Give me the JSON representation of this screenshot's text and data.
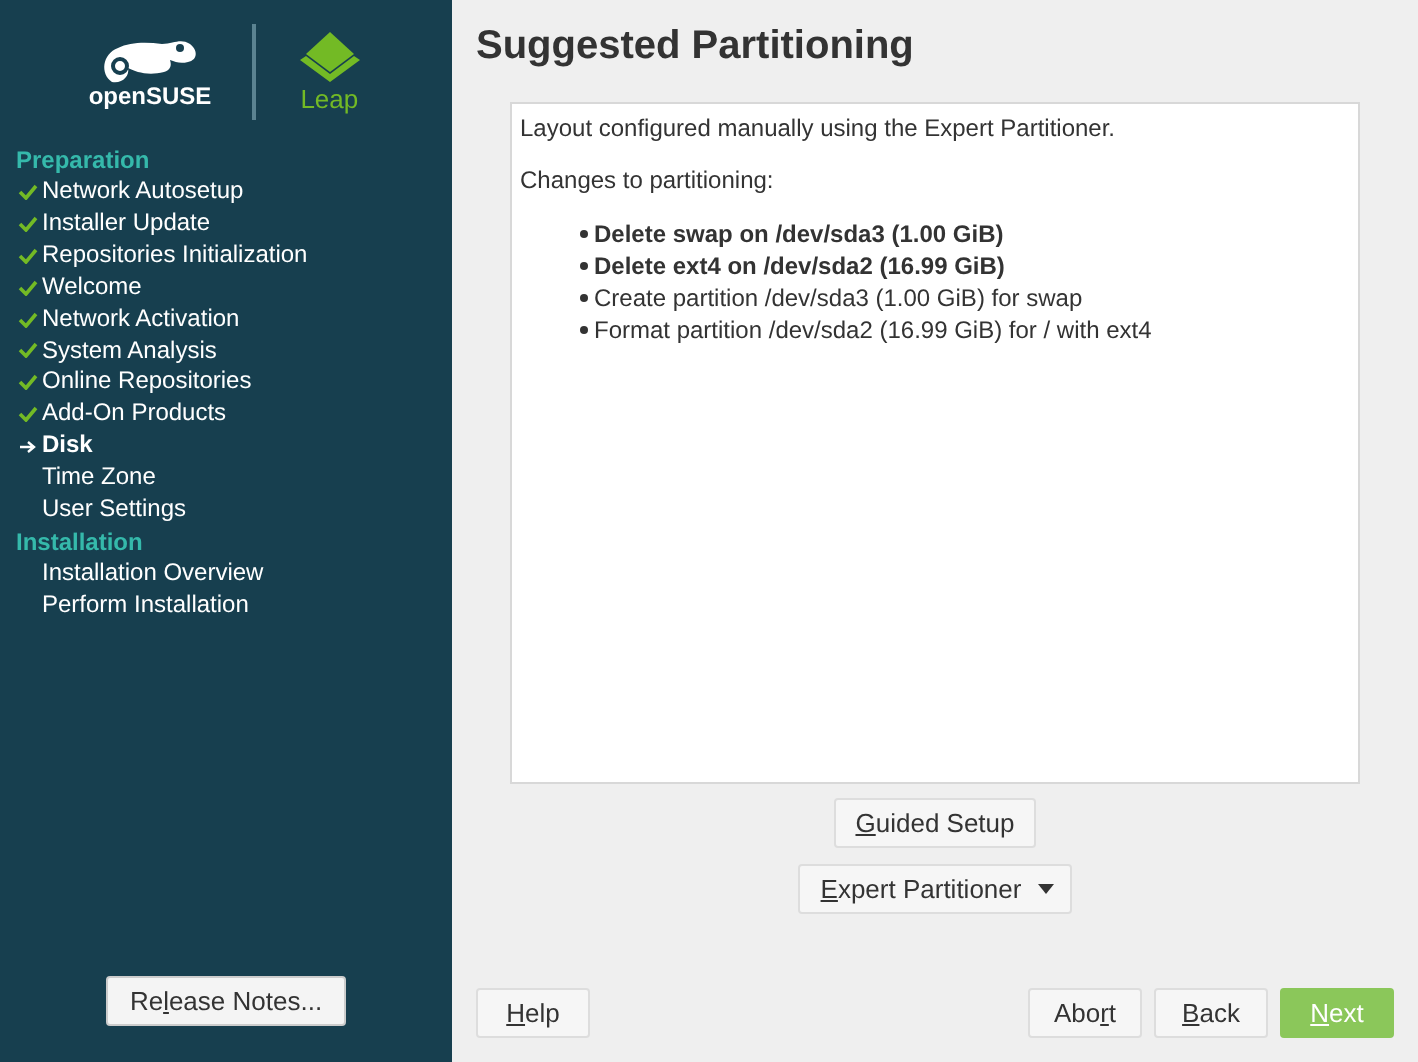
{
  "sidebar": {
    "logo_text": "openSUSE",
    "product": "Leap",
    "groups": [
      {
        "title": "Preparation",
        "items": [
          {
            "label": "Network Autosetup",
            "checked": true,
            "selected": false
          },
          {
            "label": "Installer Update",
            "checked": true,
            "selected": false
          },
          {
            "label": "Repositories Initialization",
            "checked": true,
            "selected": false
          },
          {
            "label": "Welcome",
            "checked": true,
            "selected": false
          },
          {
            "label": "Network Activation",
            "checked": true,
            "selected": false
          },
          {
            "label": "System Analysis",
            "checked": true,
            "selected": false
          },
          {
            "label": "Online Repositories",
            "checked": true,
            "selected": false
          },
          {
            "label": "Add-On Products",
            "checked": true,
            "selected": false
          },
          {
            "label": "Disk",
            "checked": false,
            "selected": true
          },
          {
            "label": "Time Zone",
            "checked": false,
            "selected": false
          },
          {
            "label": "User Settings",
            "checked": false,
            "selected": false
          }
        ]
      },
      {
        "title": "Installation",
        "items": [
          {
            "label": "Installation Overview",
            "checked": false,
            "selected": false
          },
          {
            "label": "Perform Installation",
            "checked": false,
            "selected": false
          }
        ]
      }
    ],
    "release_notes": {
      "before": "Re",
      "key": "l",
      "after": "ease Notes..."
    }
  },
  "title": "Suggested Partitioning",
  "summary": {
    "intro": "Layout configured manually using the Expert Partitioner.",
    "heading": "Changes to partitioning:",
    "changes": [
      {
        "text": "Delete swap on /dev/sda3 (1.00 GiB)",
        "kind": "destructive"
      },
      {
        "text": "Delete ext4 on /dev/sda2 (16.99 GiB)",
        "kind": "destructive"
      },
      {
        "text": "Create partition /dev/sda3 (1.00 GiB) for swap",
        "kind": "normal"
      },
      {
        "text": "Format partition /dev/sda2 (16.99 GiB) for / with ext4",
        "kind": "normal"
      }
    ]
  },
  "guided_setup": {
    "key": "G",
    "after": "uided Setup"
  },
  "expert_partitioner": {
    "key": "E",
    "after": "xpert Partitioner"
  },
  "buttons": [
    {
      "key": "H",
      "after": "elp",
      "kind": "left"
    },
    {
      "before": "Abo",
      "key": "r",
      "after": "t",
      "kind": "right"
    },
    {
      "key": "B",
      "after": "ack",
      "kind": "right"
    },
    {
      "key": "N",
      "after": "ext",
      "kind": "primary"
    }
  ]
}
